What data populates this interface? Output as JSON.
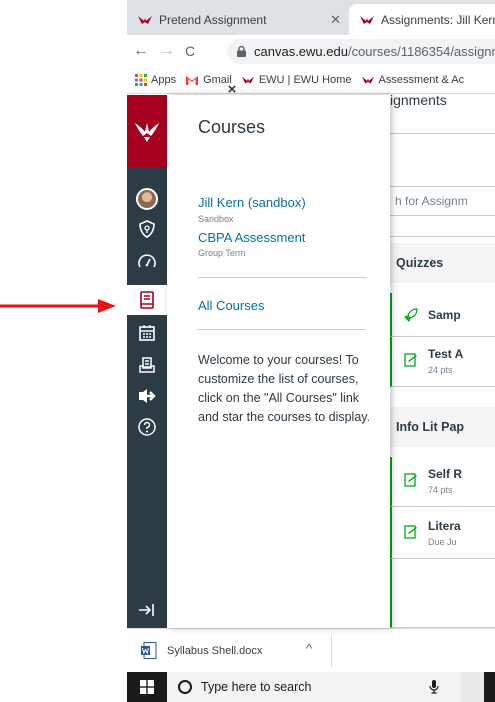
{
  "colors": {
    "canvas_nav": "#2d3b45",
    "eagle_red": "#a5001e",
    "link": "#0770a3",
    "arrow": "#e8141c"
  },
  "browser": {
    "tabs": [
      {
        "title": "Pretend Assignment",
        "icon": "eagle-favicon"
      },
      {
        "title": "Assignments: Jill Kern (",
        "icon": "eagle-favicon"
      }
    ],
    "nav": {
      "back": "←",
      "forward": "→",
      "reload": "C"
    },
    "url": {
      "host": "canvas.ewu.edu",
      "path": "/courses/1186354/assignm"
    },
    "bookmarks": [
      {
        "label": "Apps",
        "icon": "apps-grid-icon"
      },
      {
        "label": "Gmail",
        "icon": "gmail-icon"
      },
      {
        "label": "EWU | EWU Home",
        "icon": "eagle-favicon"
      },
      {
        "label": "Assessment & Ac",
        "icon": "eagle-favicon"
      }
    ]
  },
  "global_nav": {
    "items": [
      "account",
      "admin",
      "dashboard",
      "courses",
      "calendar",
      "inbox",
      "commons",
      "help"
    ],
    "active": "courses"
  },
  "tray": {
    "close": "×",
    "title": "Courses",
    "courses": [
      {
        "name": "Jill Kern (sandbox)",
        "term": "Sandbox"
      },
      {
        "name": "CBPA Assessment",
        "term": "Group Term"
      }
    ],
    "all_courses": "All Courses",
    "message": "Welcome to your courses! To customize the list of courses, click on the \"All Courses\" link and star the courses to display."
  },
  "page": {
    "title": "ignments",
    "search_placeholder": "h for Assignm",
    "groups": [
      {
        "name": "Quizzes",
        "items": [
          {
            "title": "Samp",
            "meta": "",
            "icon": "rocket-quiz-icon"
          },
          {
            "title": "Test A",
            "meta": "24 pts",
            "icon": "assignment-icon"
          }
        ]
      },
      {
        "name": "Info Lit Pap",
        "items": [
          {
            "title": "Self R",
            "meta": "74 pts",
            "icon": "assignment-icon"
          },
          {
            "title": "Litera",
            "meta": "Due Ju",
            "icon": "assignment-icon"
          }
        ]
      }
    ]
  },
  "downloads": {
    "file": "Syllabus Shell.docx",
    "chevron": "^"
  },
  "taskbar": {
    "search_placeholder": "Type here to search"
  }
}
